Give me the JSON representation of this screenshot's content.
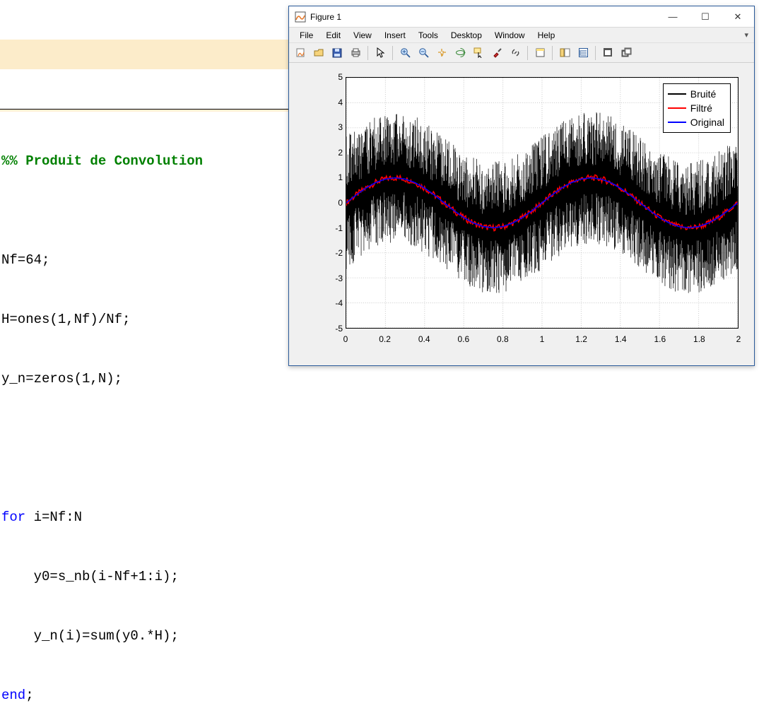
{
  "editor": {
    "section": "%% Produit de Convolution",
    "l1": "",
    "l2": "Nf=64;",
    "l3": "H=ones(1,Nf)/Nf;",
    "l4": "y_n=zeros(1,N);",
    "l5": "",
    "l6": "",
    "for_kw": "for",
    "for_rest": " i=Nf:N",
    "l8": "    y0=s_nb(i-Nf+1:i);",
    "l9": "    y_n(i)=sum(y0.*H);",
    "end_kw": "end",
    "end_semi": ";"
  },
  "window": {
    "title": "Figure 1",
    "menus": [
      "File",
      "Edit",
      "View",
      "Insert",
      "Tools",
      "Desktop",
      "Window",
      "Help"
    ],
    "toolbar_icons": [
      "new-figure",
      "open",
      "save",
      "print",
      "sep",
      "pointer",
      "sep",
      "zoom-in",
      "zoom-out",
      "pan",
      "rotate3d",
      "data-cursor",
      "brush",
      "link",
      "sep",
      "colorbar",
      "sep",
      "legend",
      "grid",
      "sep",
      "dock",
      "undock"
    ]
  },
  "chart_data": {
    "type": "line",
    "xlabel": "",
    "ylabel": "",
    "xlim": [
      0,
      2
    ],
    "ylim": [
      -5,
      5
    ],
    "xticks": [
      0,
      0.2,
      0.4,
      0.6,
      0.8,
      1,
      1.2,
      1.4,
      1.6,
      1.8,
      2
    ],
    "yticks": [
      -5,
      -4,
      -3,
      -2,
      -1,
      0,
      1,
      2,
      3,
      4,
      5
    ],
    "grid": true,
    "legend": {
      "position": "northeast",
      "entries": [
        "Bruité",
        "Filtré",
        "Original"
      ]
    },
    "series": [
      {
        "name": "Bruité",
        "color": "#000000",
        "description": "noisy signal: sin(2*pi*x) + high-amplitude noise, densely sampled, peaks up to ~5 and down to ~-5"
      },
      {
        "name": "Filtré",
        "color": "#ff0000",
        "description": "moving-average filtered version, roughly follows sin(2*pi*x) with small jitter, amplitude ~1"
      },
      {
        "name": "Original",
        "color": "#0000ff",
        "x": [
          0,
          0.05,
          0.1,
          0.15,
          0.2,
          0.25,
          0.3,
          0.35,
          0.4,
          0.45,
          0.5,
          0.55,
          0.6,
          0.65,
          0.7,
          0.75,
          0.8,
          0.85,
          0.9,
          0.95,
          1,
          1.05,
          1.1,
          1.15,
          1.2,
          1.25,
          1.3,
          1.35,
          1.4,
          1.45,
          1.5,
          1.55,
          1.6,
          1.65,
          1.7,
          1.75,
          1.8,
          1.85,
          1.9,
          1.95,
          2
        ],
        "y": [
          0,
          0.309,
          0.588,
          0.809,
          0.951,
          1,
          0.951,
          0.809,
          0.588,
          0.309,
          0,
          -0.309,
          -0.588,
          -0.809,
          -0.951,
          -1,
          -0.951,
          -0.809,
          -0.588,
          -0.309,
          0,
          0.309,
          0.588,
          0.809,
          0.951,
          1,
          0.951,
          0.809,
          0.588,
          0.309,
          0,
          -0.309,
          -0.588,
          -0.809,
          -0.951,
          -1,
          -0.951,
          -0.809,
          -0.588,
          -0.309,
          0
        ]
      }
    ]
  }
}
